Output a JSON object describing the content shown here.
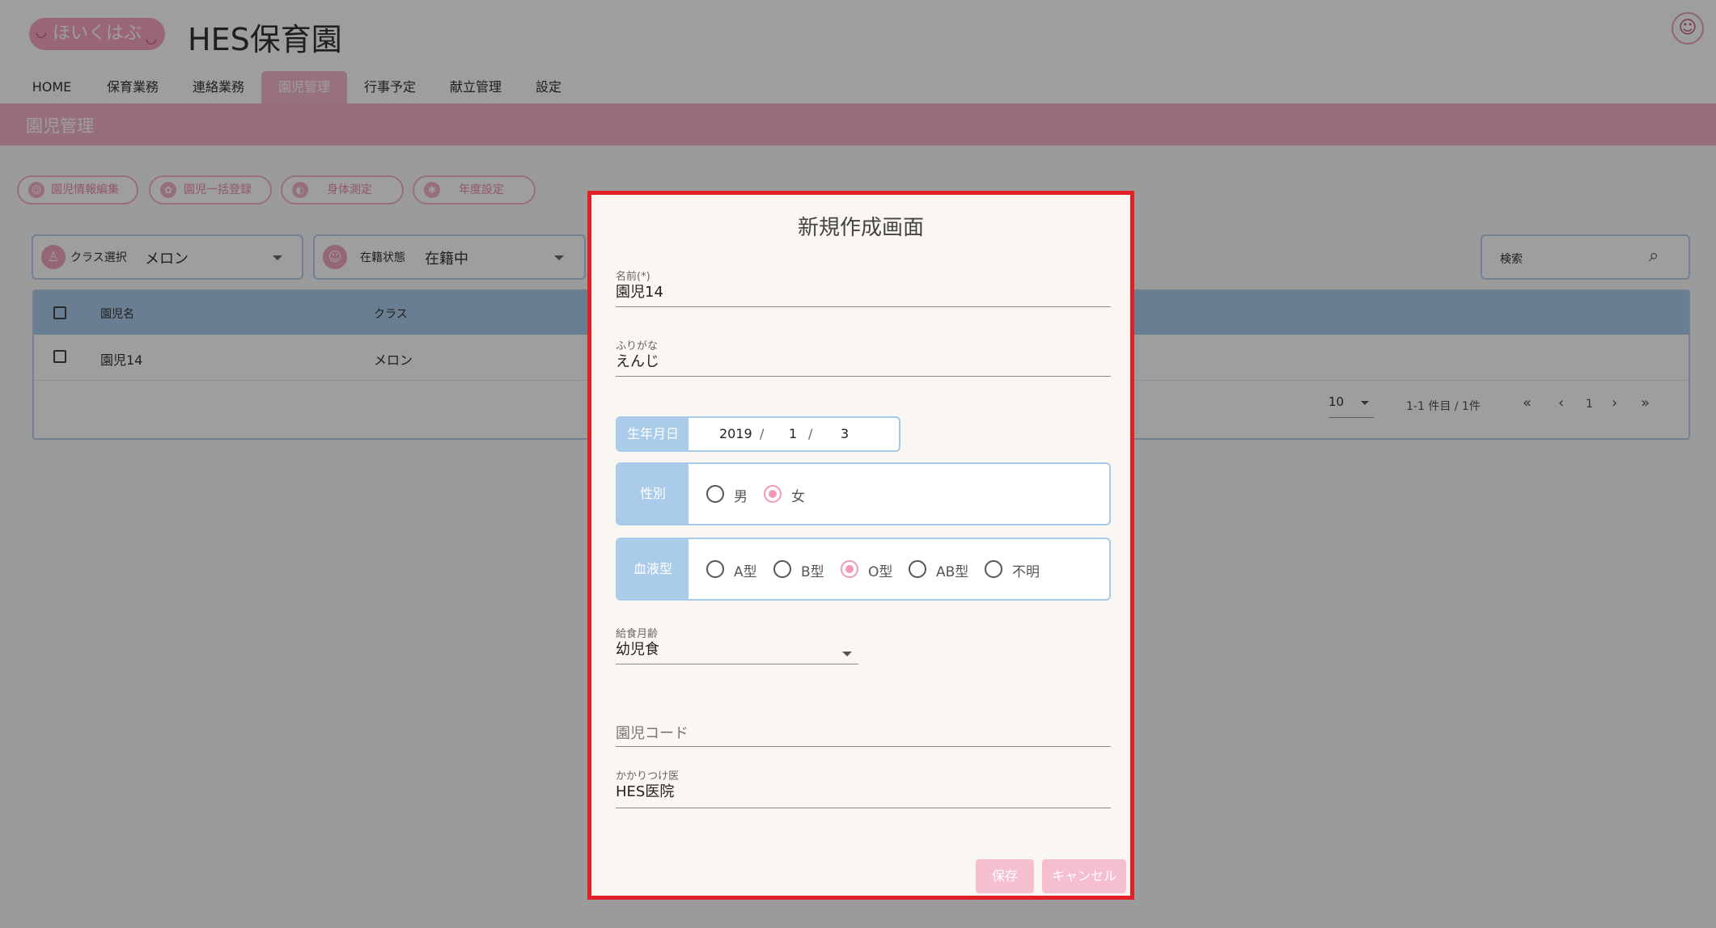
{
  "header": {
    "logo_text": "ほいくはぶ",
    "org_name": "HES保育園"
  },
  "nav": {
    "items": [
      "HOME",
      "保育業務",
      "連絡業務",
      "園児管理",
      "行事予定",
      "献立管理",
      "設定"
    ],
    "active": "園児管理"
  },
  "page": {
    "title": "園児管理"
  },
  "actions": [
    "園児情報編集",
    "園児一括登録",
    "身体測定",
    "年度設定"
  ],
  "filters": {
    "class": {
      "label": "クラス選択",
      "value": "メロン"
    },
    "status": {
      "label": "在籍状態",
      "value": "在籍中"
    },
    "search": {
      "label": "検索"
    }
  },
  "table": {
    "headers": [
      "園児名",
      "クラス"
    ],
    "rows": [
      {
        "name": "園児14",
        "class": "メロン"
      }
    ],
    "pagination": {
      "page_size": "10",
      "range": "1-1 件目 / 1件",
      "current_page": "1"
    }
  },
  "modal": {
    "title": "新規作成画面",
    "name_label": "名前(*)",
    "name_value": "園児14",
    "furigana_label": "ふりがな",
    "furigana_value": "えんじ",
    "birth_label": "生年月日",
    "birth_year": "2019",
    "birth_month": "1",
    "birth_day": "3",
    "gender_label": "性別",
    "gender_options": [
      "男",
      "女"
    ],
    "gender_selected": "女",
    "blood_label": "血液型",
    "blood_options": [
      "A型",
      "B型",
      "O型",
      "AB型",
      "不明"
    ],
    "blood_selected": "O型",
    "meal_label": "給食月齢",
    "meal_value": "幼児食",
    "code_placeholder": "園児コード",
    "doctor_label": "かかりつけ医",
    "doctor_value": "HES医院",
    "save_label": "保存",
    "cancel_label": "キャンセル"
  },
  "colors": {
    "accent_pink": "#f4b4c7",
    "accent_blue": "#abcbea",
    "modal_border": "#e01f26"
  }
}
